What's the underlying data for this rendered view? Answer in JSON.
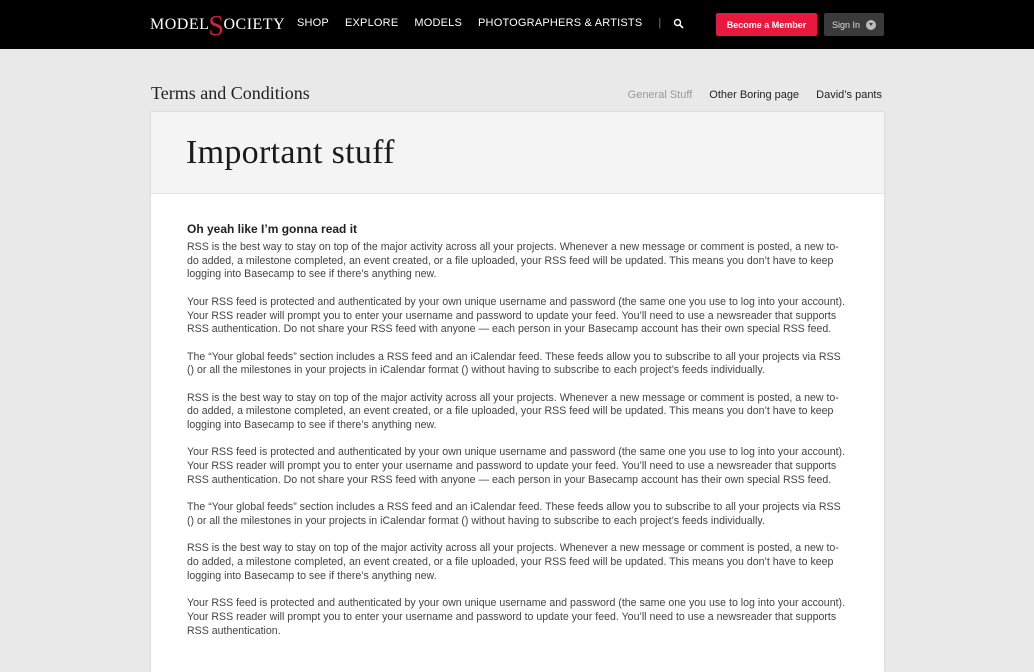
{
  "header": {
    "logo_left": "MODEL",
    "logo_s": "S",
    "logo_right": "OCIETY",
    "nav": [
      "SHOP",
      "EXPLORE",
      "MODELS",
      "PHOTOGRAPHERS & ARTISTS"
    ],
    "separator": "|",
    "member_button": "Become a Member",
    "signin_button": "Sign In"
  },
  "page": {
    "title": "Terms and Conditions",
    "tabs": [
      {
        "label": "General Stuff",
        "active": true
      },
      {
        "label": "Other Boring page",
        "active": false
      },
      {
        "label": "David’s pants",
        "active": false
      }
    ]
  },
  "card": {
    "heading": "Important stuff",
    "subheading": "Oh yeah like I’m gonna read it",
    "paragraphs": [
      "RSS is the best way to stay on top of the major activity across all your projects. Whenever a new message or comment is posted, a new to-do added, a milestone completed, an event created, or a file uploaded, your RSS feed will be updated. This means you don’t have to keep logging into Basecamp to see if there’s anything new.",
      "Your RSS feed is protected and authenticated by your own unique username and password (the same one you use to log into your account). Your RSS reader will prompt you to enter your username and password to update your feed. You’ll need to use a newsreader that supports RSS authentication. Do not share your RSS feed with anyone — each person in your Basecamp account has their own special RSS feed.",
      "The “Your global feeds” section includes a RSS feed and an iCalendar feed. These feeds allow you to subscribe to all your projects via RSS () or all the milestones in your projects in iCalendar format () without having to subscribe to each project’s feeds individually.",
      "RSS is the best way to stay on top of the major activity across all your projects. Whenever a new message or comment is posted, a new to-do added, a milestone completed, an event created, or a file uploaded, your RSS feed will be updated. This means you don’t have to keep logging into Basecamp to see if there’s anything new.",
      "Your RSS feed is protected and authenticated by your own unique username and password (the same one you use to log into your account). Your RSS reader will prompt you to enter your username and password to update your feed. You’ll need to use a newsreader that supports RSS authentication. Do not share your RSS feed with anyone — each person in your Basecamp account has their own special RSS feed.",
      "The “Your global feeds” section includes a RSS feed and an iCalendar feed. These feeds allow you to subscribe to all your projects via RSS () or all the milestones in your projects in iCalendar format () without having to subscribe to each project’s feeds individually.",
      "RSS is the best way to stay on top of the major activity across all your projects. Whenever a new message or comment is posted, a new to-do added, a milestone completed, an event created, or a file uploaded, your RSS feed will be updated. This means you don’t have to keep logging into Basecamp to see if there’s anything new.",
      "Your RSS feed is protected and authenticated by your own unique username and password (the same one you use to log into your account). Your RSS reader will prompt you to enter your username and password to update your feed. You’ll need to use a newsreader that supports RSS authentication."
    ]
  },
  "colors": {
    "accent": "#e8183f",
    "topbar": "#000000",
    "background": "#e9e9e9"
  },
  "icons": {
    "search": "search-icon",
    "signin_chevron": "chevron-down-icon"
  }
}
